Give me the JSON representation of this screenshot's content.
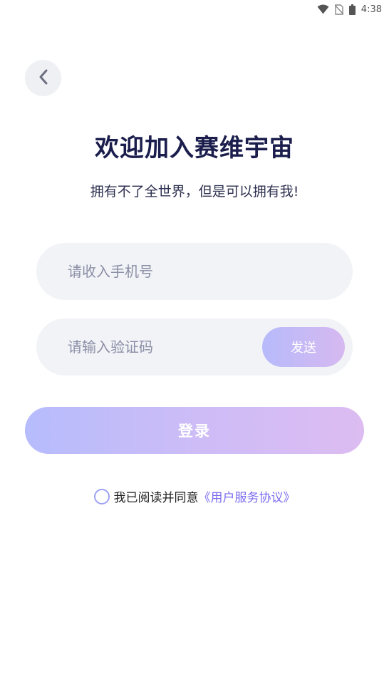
{
  "status_bar": {
    "time": "4:38",
    "icons": [
      "wifi-icon",
      "no-sim-icon",
      "battery-icon"
    ]
  },
  "header": {
    "back_icon": "chevron-left-icon",
    "title": "欢迎加入赛维宇宙",
    "subtitle": "拥有不了全世界，但是可以拥有我!"
  },
  "form": {
    "phone_placeholder": "请收入手机号",
    "phone_value": "",
    "code_placeholder": "请输入验证码",
    "code_value": "",
    "send_label": "发送",
    "login_label": "登录"
  },
  "agreement": {
    "checked": false,
    "text": "我已阅读并同意",
    "link": "《用户服务协议》"
  },
  "colors": {
    "title": "#1b1e4c",
    "field_bg": "#f2f3f7",
    "gradient_start": "#b6bcfc",
    "gradient_end": "#dcbcf1",
    "link": "#7b6cf0"
  }
}
